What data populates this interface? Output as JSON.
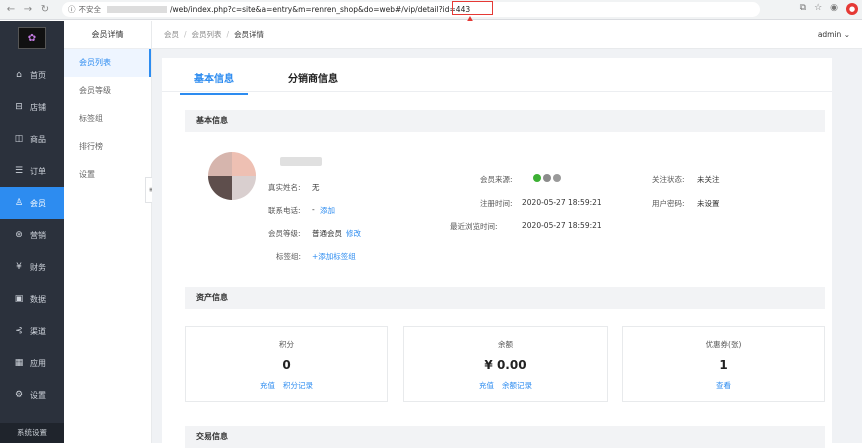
{
  "browser": {
    "security_label": "不安全",
    "url": "/web/index.php?c=site&a=entry&m=renren_shop&do=web#/vip/detail?id=443"
  },
  "sidebar": {
    "logo_icon": "app-logo",
    "items": [
      {
        "label": "首页",
        "icon": "home-icon",
        "glyph": "⌂"
      },
      {
        "label": "店铺",
        "icon": "store-icon",
        "glyph": "⊟"
      },
      {
        "label": "商品",
        "icon": "goods-icon",
        "glyph": "◫"
      },
      {
        "label": "订单",
        "icon": "order-icon",
        "glyph": "☰"
      },
      {
        "label": "会员",
        "icon": "member-icon",
        "glyph": "♙",
        "active": true
      },
      {
        "label": "营销",
        "icon": "marketing-icon",
        "glyph": "⊛"
      },
      {
        "label": "财务",
        "icon": "finance-icon",
        "glyph": "¥"
      },
      {
        "label": "数据",
        "icon": "data-icon",
        "glyph": "▣"
      },
      {
        "label": "渠道",
        "icon": "channel-icon",
        "glyph": "⊰"
      },
      {
        "label": "应用",
        "icon": "apps-icon",
        "glyph": "▦"
      },
      {
        "label": "设置",
        "icon": "settings-icon",
        "glyph": "⚙"
      }
    ],
    "bottom": "系统设置"
  },
  "subnav": {
    "title": "会员详情",
    "items": [
      "会员列表",
      "会员等级",
      "标签组",
      "排行榜",
      "设置"
    ]
  },
  "breadcrumb": [
    "会员",
    "会员列表",
    "会员详情"
  ],
  "user_menu": "admin",
  "tabs": [
    "基本信息",
    "分销商信息"
  ],
  "sections": {
    "basic": "基本信息",
    "assets": "资产信息",
    "trade": "交易信息"
  },
  "profile": {
    "real_name_label": "真实姓名:",
    "real_name": "无",
    "phone_label": "联系电话:",
    "phone": "-",
    "phone_add": "添加",
    "level_label": "会员等级:",
    "level": "普通会员",
    "level_edit": "修改",
    "tag_label": "标签组:",
    "tag_add": "+添加标签组",
    "source_label": "会员来源:",
    "register_label": "注册时间:",
    "register_time": "2020-05-27 18:59:21",
    "browse_label": "最近浏览时间:",
    "browse_time": "2020-05-27 18:59:21",
    "follow_label": "关注状态:",
    "follow": "未关注",
    "pwd_label": "用户密码:",
    "pwd": "未设置"
  },
  "assets": [
    {
      "title": "积分",
      "value": "0",
      "links": [
        "充值",
        "积分记录"
      ]
    },
    {
      "title": "余额",
      "value": "¥ 0.00",
      "links": [
        "充值",
        "余额记录"
      ]
    },
    {
      "title": "优惠券(张)",
      "value": "1",
      "links": [
        "查看"
      ]
    }
  ],
  "colors": {
    "accent": "#2d8cf0",
    "sidebar": "#2b313c",
    "annotation": "#e53935"
  }
}
